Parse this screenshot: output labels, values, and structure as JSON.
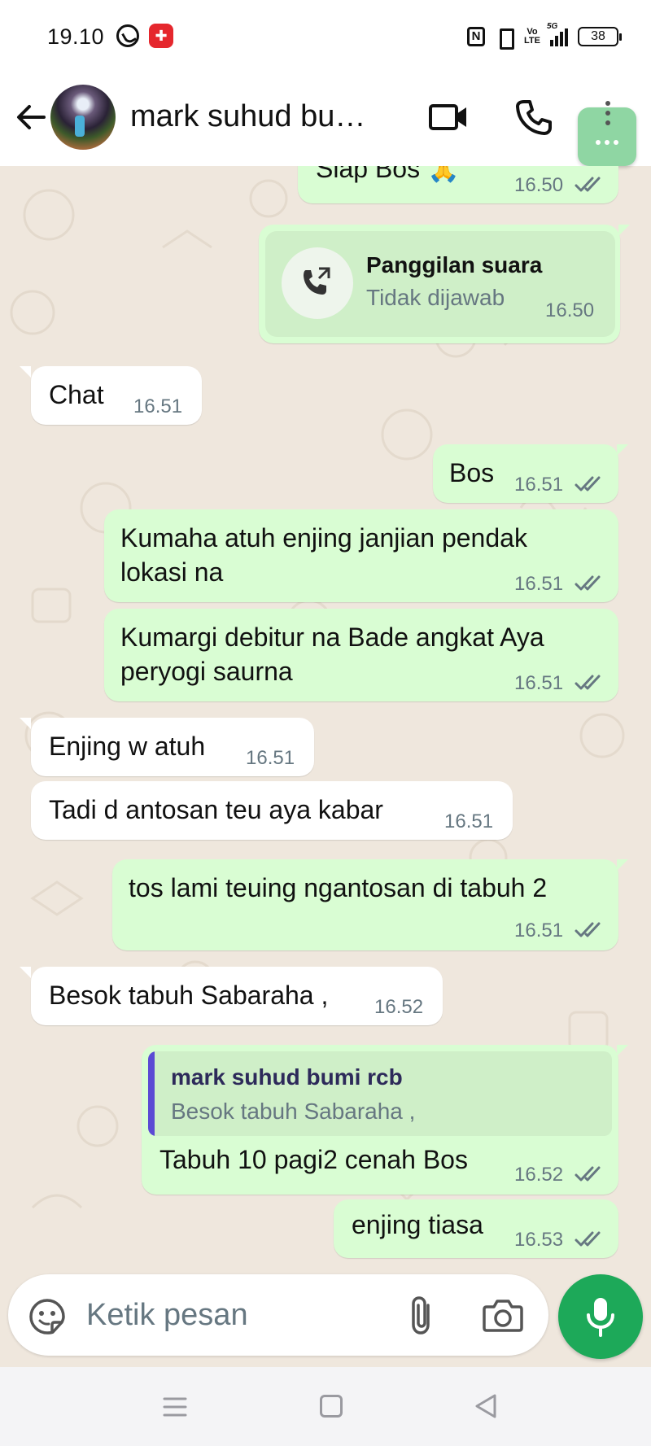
{
  "status_bar": {
    "time": "19.10",
    "nfc": "N",
    "volte": "Vo LTE",
    "network": "5G",
    "battery": "38"
  },
  "header": {
    "contact_name": "mark suhud bumi...",
    "back_icon": "arrow-left-icon",
    "video_icon": "video-camera-icon",
    "call_icon": "phone-icon",
    "menu_icon": "more-vert-icon"
  },
  "messages": [
    {
      "dir": "out",
      "text": "Siap Bos 🙏",
      "time": "16.50",
      "read": true
    },
    {
      "dir": "out",
      "type": "call",
      "title": "Panggilan suara",
      "subtitle": "Tidak dijawab",
      "time": "16.50"
    },
    {
      "dir": "in",
      "text": "Chat",
      "time": "16.51"
    },
    {
      "dir": "out",
      "text": "Bos",
      "time": "16.51",
      "read": true
    },
    {
      "dir": "out",
      "text_line1": "Kumaha atuh enjing janjian pendak",
      "text_line2": "lokasi na",
      "time": "16.51",
      "read": true
    },
    {
      "dir": "out",
      "text_line1": "Kumargi debitur na Bade angkat Aya",
      "text_line2": "peryogi saurna",
      "time": "16.51",
      "read": true
    },
    {
      "dir": "in",
      "text": "Enjing w atuh",
      "time": "16.51"
    },
    {
      "dir": "in",
      "text": "Tadi d antosan teu aya kabar",
      "time": "16.51"
    },
    {
      "dir": "out",
      "text": "tos lami teuing ngantosan di tabuh 2",
      "time": "16.51",
      "read": true
    },
    {
      "dir": "in",
      "text": "Besok tabuh Sabaraha ,",
      "time": "16.52"
    },
    {
      "dir": "out",
      "type": "reply",
      "quote_name": "mark suhud bumi rcb",
      "quote_text": "Besok tabuh Sabaraha ,",
      "text": "Tabuh 10 pagi2 cenah Bos",
      "time": "16.52",
      "read": true
    },
    {
      "dir": "out",
      "text": "enjing tiasa",
      "time": "16.53",
      "read": true
    }
  ],
  "composer": {
    "placeholder": "Ketik pesan",
    "emoji_icon": "sticker-icon",
    "attach_icon": "paperclip-icon",
    "camera_icon": "camera-icon",
    "mic_icon": "microphone-icon"
  },
  "colors": {
    "outgoing_bubble": "#d9fdd3",
    "incoming_bubble": "#ffffff",
    "wallpaper": "#efe7dd",
    "accent_green": "#1da959",
    "read_ticks": "#667781",
    "quote_bar": "#5b4ad4"
  }
}
